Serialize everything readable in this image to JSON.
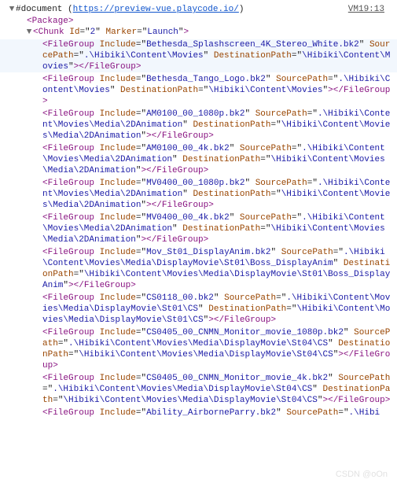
{
  "topline": {
    "doc_label": "#document",
    "url": "https://preview-vue.playcode.io/",
    "vm_link": "VM19:13"
  },
  "nodes": {
    "package_tag": "Package",
    "chunk": {
      "tag": "Chunk",
      "id_attr": "Id",
      "id_val": "2",
      "marker_attr": "Marker",
      "marker_val": "Launch"
    },
    "items": [
      {
        "include": "Bethesda_Splashscreen_4K_Stereo_White.bk2",
        "source": ".\\Hibiki\\Content\\Movies",
        "dest": "\\Hibiki\\Content\\Movies",
        "hl": true
      },
      {
        "include": "Bethesda_Tango_Logo.bk2",
        "source": ".\\Hibiki\\Content\\Movies",
        "dest": "\\Hibiki\\Content\\Movies",
        "hl": false
      },
      {
        "include": "AM0100_00_1080p.bk2",
        "source": ".\\Hibiki\\Content\\Movies\\Media\\2DAnimation",
        "dest": "\\Hibiki\\Content\\Movies\\Media\\2DAnimation",
        "hl": false
      },
      {
        "include": "AM0100_00_4k.bk2",
        "source": ".\\Hibiki\\Content\\Movies\\Media\\2DAnimation",
        "dest": "\\Hibiki\\Content\\Movies\\Media\\2DAnimation",
        "hl": false
      },
      {
        "include": "MV0400_00_1080p.bk2",
        "source": ".\\Hibiki\\Content\\Movies\\Media\\2DAnimation",
        "dest": "\\Hibiki\\Content\\Movies\\Media\\2DAnimation",
        "hl": false
      },
      {
        "include": "MV0400_00_4k.bk2",
        "source": ".\\Hibiki\\Content\\Movies\\Media\\2DAnimation",
        "dest": "\\Hibiki\\Content\\Movies\\Media\\2DAnimation",
        "hl": false
      },
      {
        "include": "Mov_St01_DisplayAnim.bk2",
        "source": ".\\Hibiki\\Content\\Movies\\Media\\DisplayMovie\\St01\\Boss_DisplayAnim",
        "dest": "\\Hibiki\\Content\\Movies\\Media\\DisplayMovie\\St01\\Boss_DisplayAnim",
        "hl": false
      },
      {
        "include": "CS0118_00.bk2",
        "source": ".\\Hibiki\\Content\\Movies\\Media\\DisplayMovie\\St01\\CS",
        "dest": "\\Hibiki\\Content\\Movies\\Media\\DisplayMovie\\St01\\CS",
        "hl": false
      },
      {
        "include": "CS0405_00_CNMN_Monitor_movie_1080p.bk2",
        "source": ".\\Hibiki\\Content\\Movies\\Media\\DisplayMovie\\St04\\CS",
        "dest": "\\Hibiki\\Content\\Movies\\Media\\DisplayMovie\\St04\\CS",
        "hl": false
      },
      {
        "include": "CS0405_00_CNMN_Monitor_movie_4k.bk2",
        "source": ".\\Hibiki\\Content\\Movies\\Media\\DisplayMovie\\St04\\CS",
        "dest": "\\Hibiki\\Content\\Movies\\Media\\DisplayMovie\\St04\\CS",
        "hl": false
      },
      {
        "include": "Ability_AirborneParry.bk2",
        "source_partial": ".\\Hibi",
        "dest": null,
        "hl": false,
        "truncated": true
      }
    ],
    "fg_tag": "FileGroup",
    "attrs": {
      "include": "Include",
      "source": "SourcePath",
      "dest": "DestinationPath"
    }
  },
  "watermark": "CSDN @oOn"
}
